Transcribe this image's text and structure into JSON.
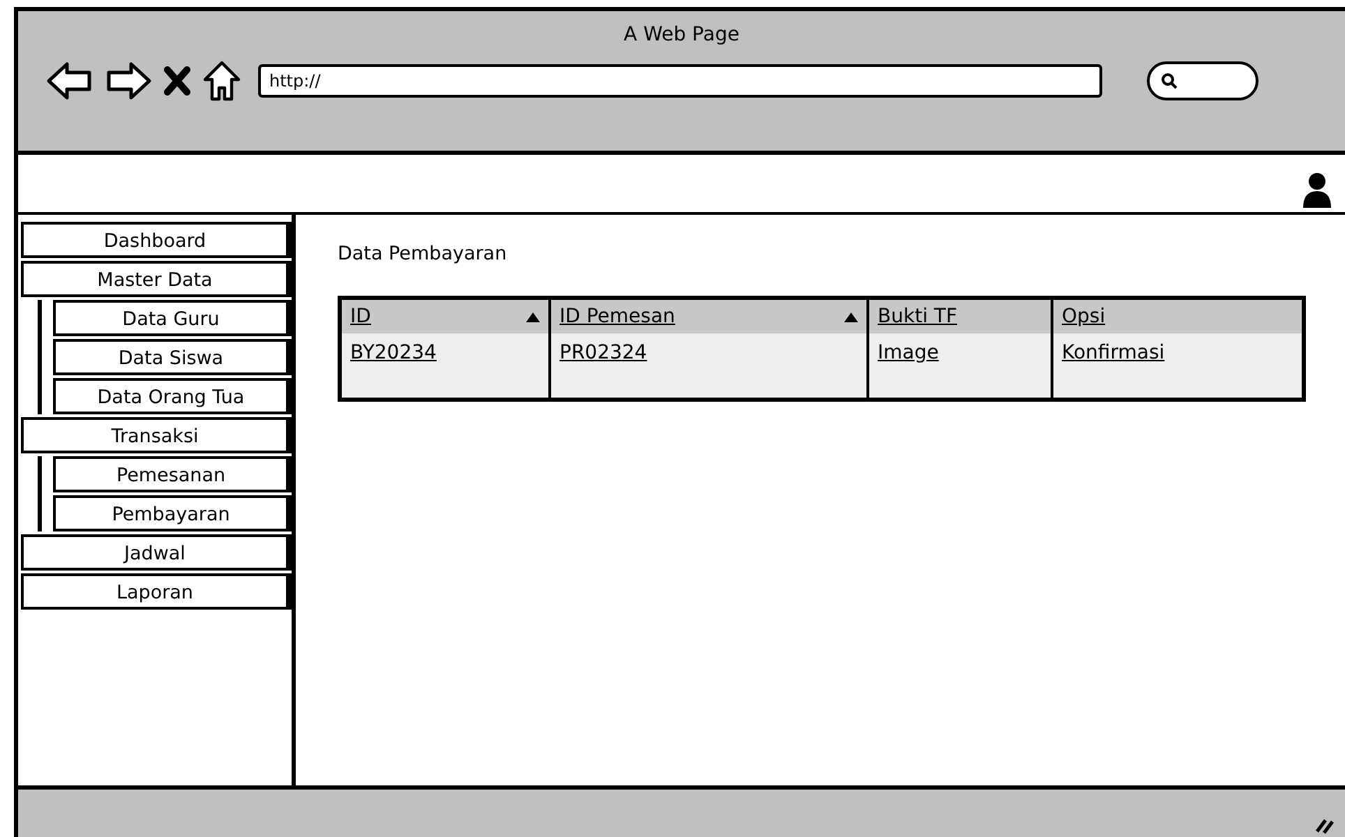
{
  "window": {
    "title": "A Web Page",
    "address": "http://"
  },
  "sidebar": {
    "items": [
      {
        "label": "Dashboard"
      },
      {
        "label": "Master Data",
        "children": [
          {
            "label": "Data Guru"
          },
          {
            "label": "Data Siswa"
          },
          {
            "label": "Data Orang Tua"
          }
        ]
      },
      {
        "label": "Transaksi",
        "children": [
          {
            "label": "Pemesanan"
          },
          {
            "label": "Pembayaran"
          }
        ]
      },
      {
        "label": "Jadwal"
      },
      {
        "label": "Laporan"
      }
    ]
  },
  "content": {
    "title": "Data Pembayaran"
  },
  "table": {
    "columns": [
      {
        "label": "ID",
        "sorted": true
      },
      {
        "label": "ID Pemesan",
        "sorted": true
      },
      {
        "label": "Bukti TF",
        "sorted": false
      },
      {
        "label": "Opsi",
        "sorted": false
      }
    ],
    "rows": [
      [
        "BY20234",
        "PR02324",
        "Image",
        "Konfirmasi"
      ]
    ]
  }
}
